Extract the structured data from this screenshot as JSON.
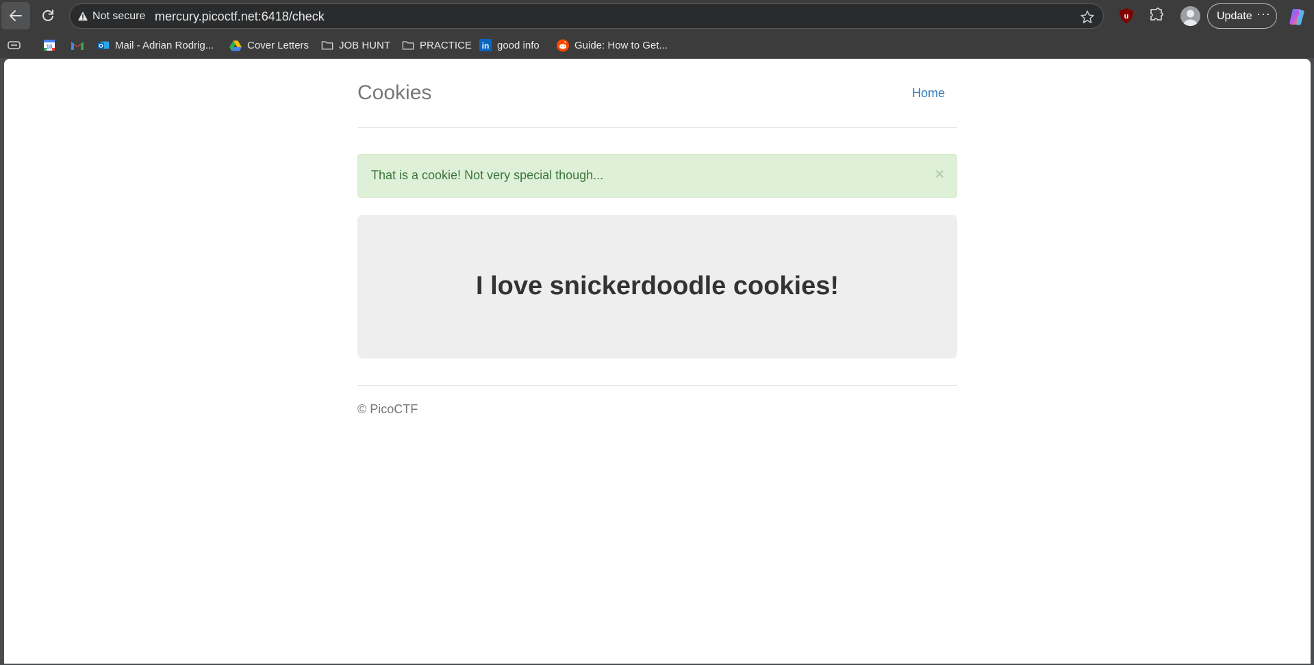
{
  "browser": {
    "omnibox": {
      "security_label": "Not secure",
      "url": "mercury.picoctf.net:6418/check"
    },
    "update_label": "Update",
    "more_label": "···",
    "bookmarks": [
      {
        "label": "",
        "icon": "google-calendar-icon"
      },
      {
        "label": "",
        "icon": "gmail-icon"
      },
      {
        "label": "Mail - Adrian Rodrig...",
        "icon": "outlook-icon"
      },
      {
        "label": "Cover Letters",
        "icon": "google-drive-icon"
      },
      {
        "label": "JOB HUNT",
        "icon": "folder-icon"
      },
      {
        "label": "PRACTICE",
        "icon": "folder-icon"
      },
      {
        "label": "good info",
        "icon": "linkedin-icon"
      },
      {
        "label": "Guide: How to Get...",
        "icon": "reddit-icon"
      }
    ]
  },
  "page": {
    "brand": "Cookies",
    "nav": {
      "home": "Home"
    },
    "alert": {
      "text": "That is a cookie! Not very special though...",
      "close": "×"
    },
    "jumbotron": {
      "title": "I love snickerdoodle cookies!"
    },
    "footer": "© PicoCTF"
  },
  "colors": {
    "chrome_bg": "#3c3c3c",
    "link": "#337ab7",
    "alert_bg": "#dff0d8",
    "alert_text": "#3c763d",
    "jumbotron_bg": "#eeeeee"
  }
}
